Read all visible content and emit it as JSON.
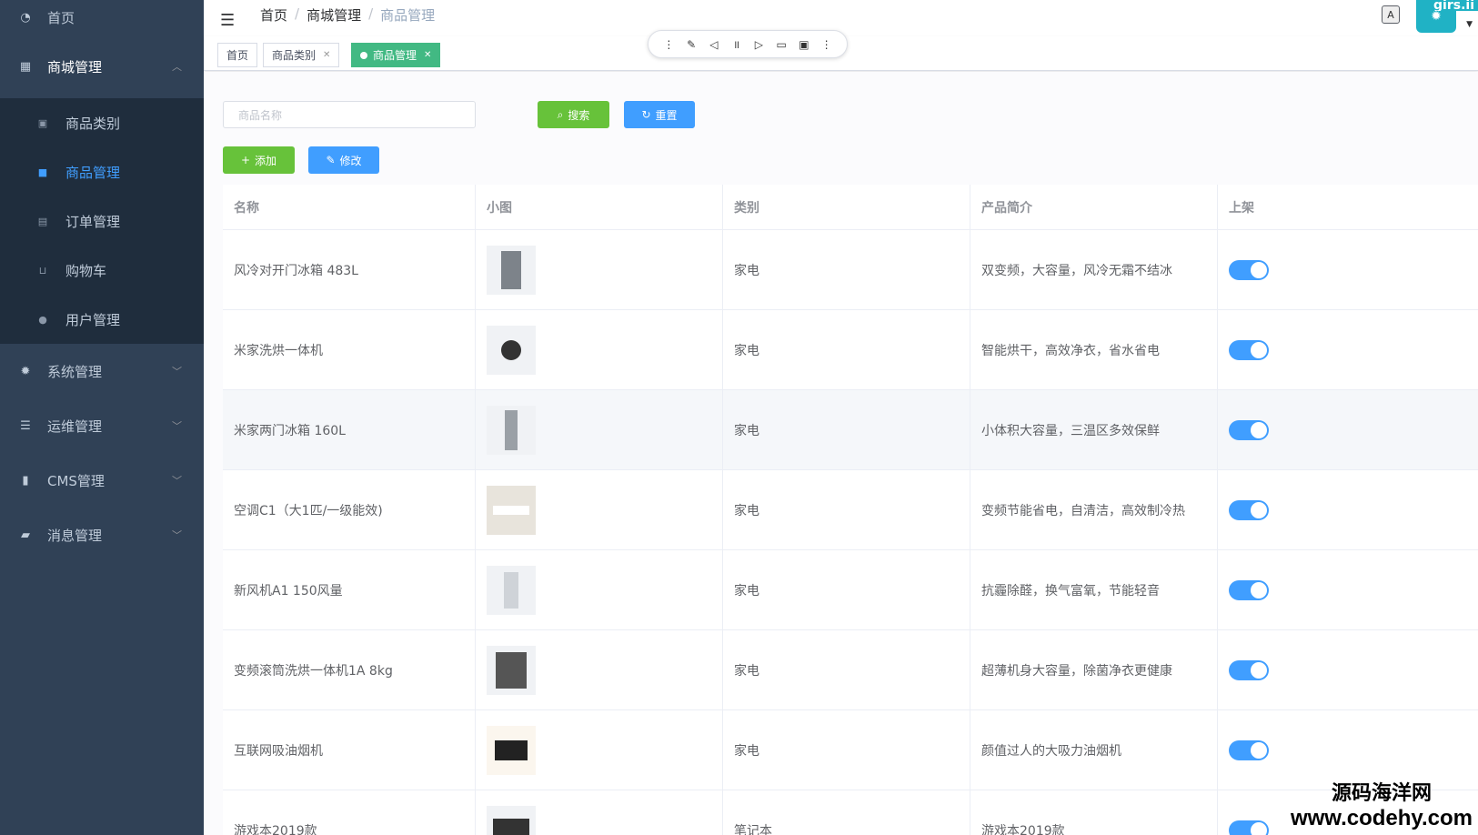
{
  "sidebar": {
    "home": "首页",
    "mall": {
      "label": "商城管理",
      "items": [
        {
          "label": "商品类别",
          "icon": "grid-icon"
        },
        {
          "label": "商品管理",
          "icon": "box-icon",
          "active": true
        },
        {
          "label": "订单管理",
          "icon": "document-icon"
        },
        {
          "label": "购物车",
          "icon": "cart-icon"
        },
        {
          "label": "用户管理",
          "icon": "user-icon"
        }
      ]
    },
    "groups": [
      {
        "label": "系统管理",
        "icon": "gear-icon"
      },
      {
        "label": "运维管理",
        "icon": "server-icon"
      },
      {
        "label": "CMS管理",
        "icon": "file-icon"
      },
      {
        "label": "消息管理",
        "icon": "chat-icon"
      }
    ]
  },
  "header": {
    "breadcrumb": [
      "首页",
      "商城管理",
      "商品管理"
    ],
    "watermark_top": "girs.ii"
  },
  "tags": [
    {
      "label": "首页"
    },
    {
      "label": "商品类别"
    },
    {
      "label": "商品管理",
      "active": true
    }
  ],
  "toolbar": {
    "search_placeholder": "商品名称",
    "search_label": "搜索",
    "reset_label": "重置",
    "add_label": "添加",
    "edit_label": "修改"
  },
  "table": {
    "columns": [
      "名称",
      "小图",
      "类别",
      "产品简介",
      "上架"
    ],
    "rows": [
      {
        "name": "风冷对开门冰箱 483L",
        "category": "家电",
        "desc": "双变频，大容量，风冷无霜不结冰",
        "on": true
      },
      {
        "name": "米家洗烘一体机",
        "category": "家电",
        "desc": "智能烘干，高效净衣，省水省电",
        "on": true
      },
      {
        "name": "米家两门冰箱 160L",
        "category": "家电",
        "desc": "小体积大容量，三温区多效保鲜",
        "on": true
      },
      {
        "name": "空调C1（大1匹/一级能效)",
        "category": "家电",
        "desc": "变频节能省电，自清洁，高效制冷热",
        "on": true
      },
      {
        "name": "新风机A1 150风量",
        "category": "家电",
        "desc": "抗霾除醛，换气富氧，节能轻音",
        "on": true
      },
      {
        "name": "变频滚筒洗烘一体机1A 8kg",
        "category": "家电",
        "desc": "超薄机身大容量，除菌净衣更健康",
        "on": true
      },
      {
        "name": "互联网吸油烟机",
        "category": "家电",
        "desc": "颜值过人的大吸力油烟机",
        "on": true
      },
      {
        "name": "游戏本2019款",
        "category": "笔记本",
        "desc": "游戏本2019款",
        "on": true
      }
    ]
  },
  "watermark": {
    "line1": "源码海洋网",
    "line2": "www.codehy.com"
  }
}
